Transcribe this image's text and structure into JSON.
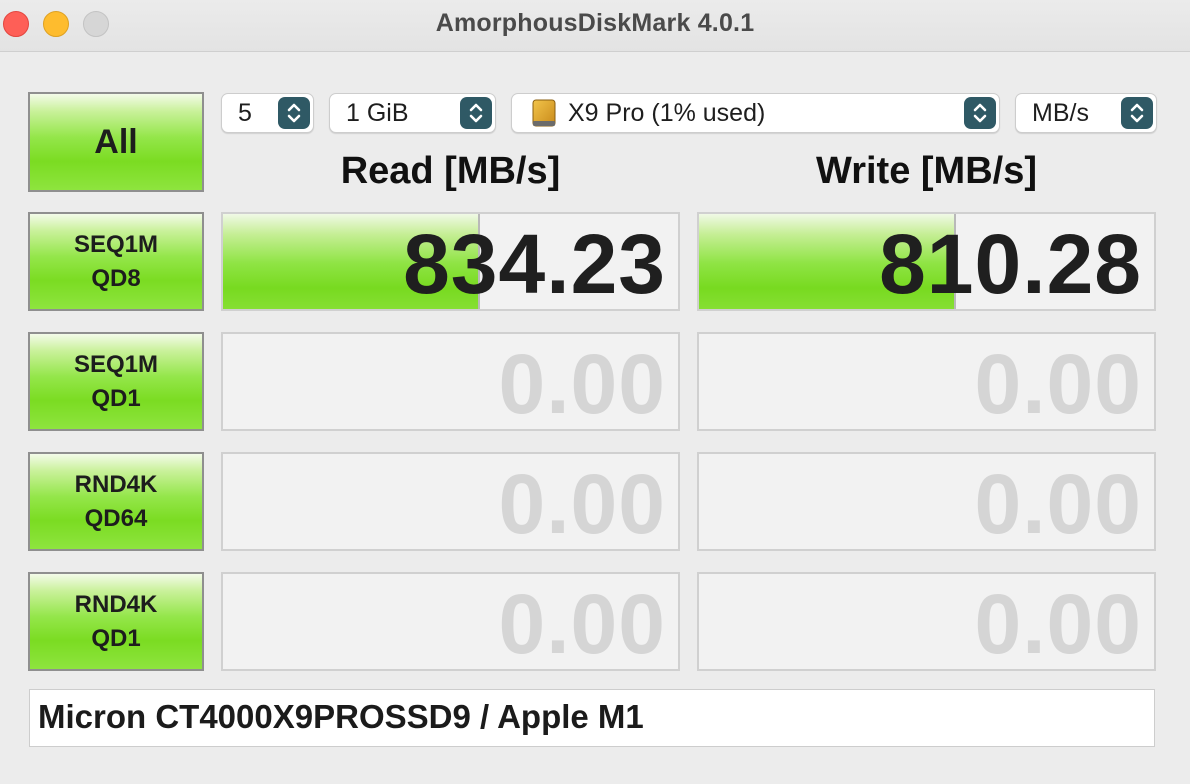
{
  "window": {
    "title": "AmorphousDiskMark 4.0.1"
  },
  "controls": {
    "count": {
      "value": "5"
    },
    "size": {
      "value": "1 GiB"
    },
    "drive": {
      "value": "X9 Pro (1% used)",
      "icon": "drive-icon"
    },
    "unit": {
      "value": "MB/s"
    }
  },
  "buttons": {
    "all": "All"
  },
  "headers": {
    "read": "Read [MB/s]",
    "write": "Write [MB/s]"
  },
  "tests": [
    {
      "line1": "SEQ1M",
      "line2": "QD8",
      "read": "834.23",
      "write": "810.28",
      "read_fill": 0.56,
      "write_fill": 0.56
    },
    {
      "line1": "SEQ1M",
      "line2": "QD1",
      "read": "0.00",
      "write": "0.00",
      "read_fill": 0,
      "write_fill": 0
    },
    {
      "line1": "RND4K",
      "line2": "QD64",
      "read": "0.00",
      "write": "0.00",
      "read_fill": 0,
      "write_fill": 0
    },
    {
      "line1": "RND4K",
      "line2": "QD1",
      "read": "0.00",
      "write": "0.00",
      "read_fill": 0,
      "write_fill": 0
    }
  ],
  "comment": "Micron CT4000X9PROSSD9 / Apple M1",
  "colors": {
    "accent_green": "#7bdc22",
    "stepper": "#2f5965",
    "zero_value": "#d5d5d5"
  }
}
